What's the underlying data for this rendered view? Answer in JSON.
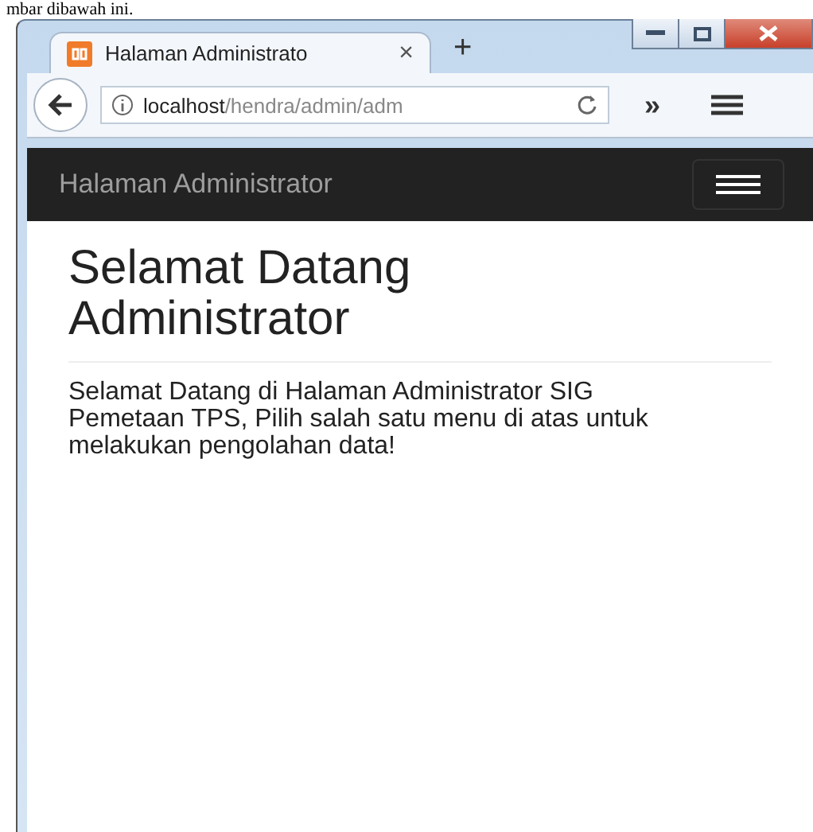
{
  "caption": "mbar dibawah ini.",
  "browser": {
    "tab": {
      "title": "Halaman Administrato",
      "close": "×"
    },
    "new_tab": "+",
    "url": {
      "host": "localhost",
      "path": "/hendra/admin/adm"
    },
    "overflow": "»"
  },
  "navbar": {
    "brand": "Halaman Administrator"
  },
  "page": {
    "heading": "Selamat Datang Administrator",
    "text": "Selamat Datang di Halaman Administrator SIG Pemetaan TPS, Pilih salah satu menu di atas untuk melakukan pengolahan data!"
  }
}
